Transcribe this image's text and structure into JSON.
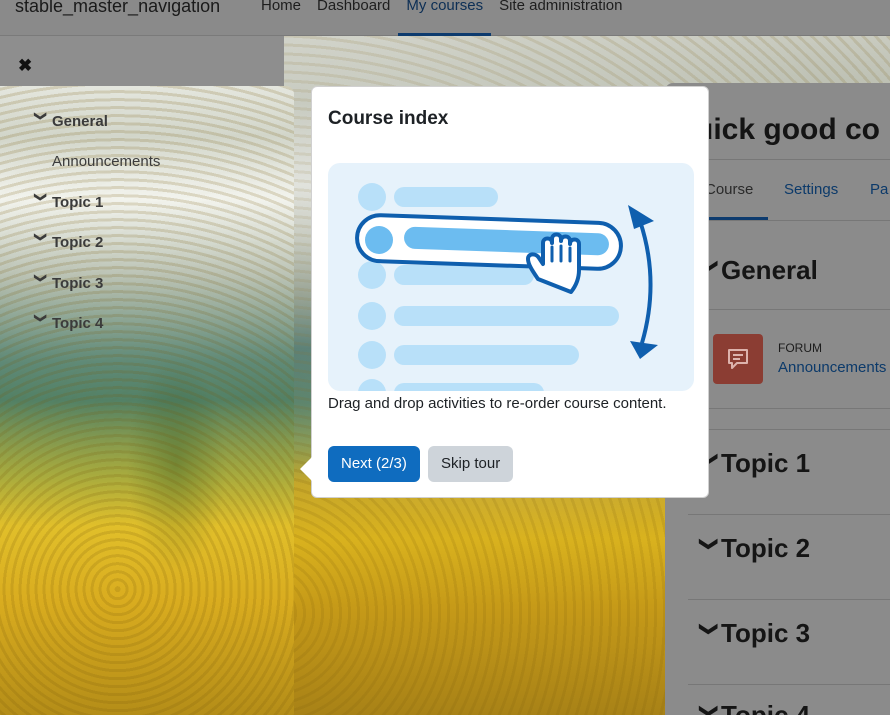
{
  "navbar": {
    "brand": "stable_master_navigation",
    "items": [
      {
        "label": "Home",
        "active": false
      },
      {
        "label": "Dashboard",
        "active": false
      },
      {
        "label": "My courses",
        "active": true
      },
      {
        "label": "Site administration",
        "active": false
      }
    ]
  },
  "drawer": {
    "close_glyph": "✖",
    "course_index": [
      {
        "label": "General",
        "type": "section"
      },
      {
        "label": "Announcements",
        "type": "activity"
      },
      {
        "label": "Topic 1",
        "type": "section"
      },
      {
        "label": "Topic 2",
        "type": "section"
      },
      {
        "label": "Topic 3",
        "type": "section"
      },
      {
        "label": "Topic 4",
        "type": "section"
      }
    ]
  },
  "course_page": {
    "title_visible": "uick good co",
    "tabs": {
      "course": "Course",
      "settings": "Settings",
      "participants_partial": "Pa"
    },
    "sections": [
      "General",
      "Topic 1",
      "Topic 2",
      "Topic 3",
      "Topic 4"
    ],
    "forum_type": "FORUM",
    "forum_link": "Announcements"
  },
  "tour": {
    "title": "Course index",
    "description": "Drag and drop activities to re-order course content.",
    "next_label": "Next (2/3)",
    "skip_label": "Skip tour"
  },
  "colors": {
    "primary": "#0f6cbf",
    "secondary_btn": "#ced4da",
    "illustration_bg": "#e6f2fb",
    "illustration_dark": "#0f5fae",
    "illustration_light": "#b8e0f9",
    "forum_icon_bg": "#8b3d33"
  }
}
